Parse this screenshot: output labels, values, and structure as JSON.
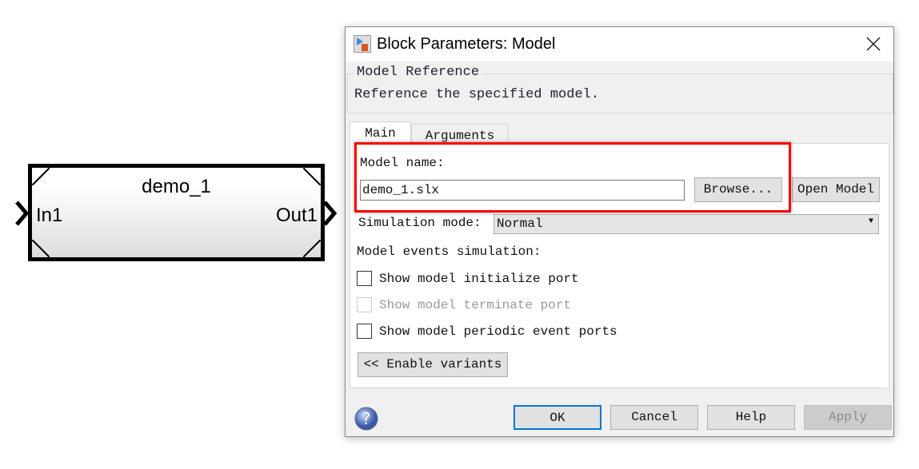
{
  "block": {
    "name": "demo_1",
    "in_port": "In1",
    "out_port": "Out1"
  },
  "dialog": {
    "title": "Block Parameters: Model",
    "group_title": "Model Reference",
    "description": "Reference the specified model.",
    "tabs": [
      {
        "label": "Main",
        "active": true
      },
      {
        "label": "Arguments",
        "active": false
      }
    ],
    "model_name_label": "Model name:",
    "model_name_value": "demo_1.slx",
    "browse_label": "Browse...",
    "open_model_label": "Open Model",
    "simulation_mode_label": "Simulation mode:",
    "simulation_mode_value": "Normal",
    "events_label": "Model events simulation:",
    "checkboxes": [
      {
        "label": "Show model initialize port",
        "checked": false,
        "enabled": true
      },
      {
        "label": "Show model terminate port",
        "checked": false,
        "enabled": false
      },
      {
        "label": "Show model periodic event ports",
        "checked": false,
        "enabled": true
      }
    ],
    "variants_label": "<< Enable variants",
    "buttons": {
      "ok": "OK",
      "cancel": "Cancel",
      "help": "Help",
      "apply": "Apply"
    },
    "highlight_color": "#ff0000"
  }
}
